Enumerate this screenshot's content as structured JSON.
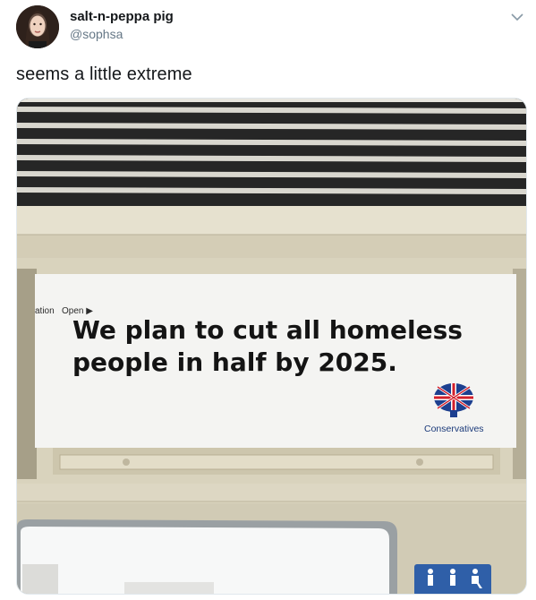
{
  "tweet": {
    "display_name": "salt-n-peppa pig",
    "handle": "@sophsa",
    "text": "seems a little extreme",
    "menu_icon": "chevron-down-icon"
  },
  "photo": {
    "sign_line_1": "We plan to cut all homeless",
    "sign_line_2": "people in half by 2025.",
    "sign_brand": "Conservatives",
    "door_label_left": "ation",
    "door_label_open": "Open",
    "brand_logo": "union-jack-tree-logo",
    "wheelchair_sign": "accessibility-icon"
  },
  "colors": {
    "handle_gray": "#657786",
    "brand_blue": "#1b3a7a",
    "sign_white": "#f4f4f2",
    "train_panel": "#d8d2bd"
  }
}
